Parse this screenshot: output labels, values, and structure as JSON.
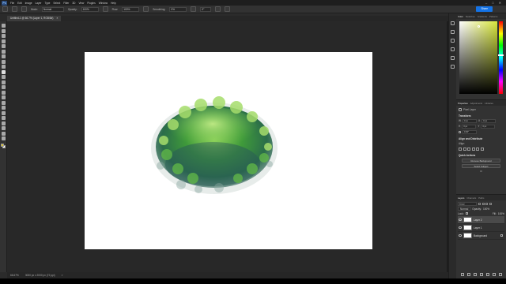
{
  "app": {
    "menu": [
      "File",
      "Edit",
      "Image",
      "Layer",
      "Type",
      "Select",
      "Filter",
      "3D",
      "View",
      "Plugins",
      "Window",
      "Help"
    ],
    "window_controls": [
      "–",
      "□",
      "✕"
    ]
  },
  "options_bar": {
    "mode_label": "Mode:",
    "mode_value": "Normal",
    "opacity_label": "Opacity:",
    "opacity_value": "100%",
    "flow_label": "Flow:",
    "flow_value": "100%",
    "smoothing_label": "Smoothing:",
    "smoothing_value": "0%",
    "angle_value": "0°",
    "share_label": "Share"
  },
  "document": {
    "tab_title": "Untitled-1 @ 66.7% (Layer 1, RGB/8#)",
    "tab_close": "×",
    "canvas_bg": "#ffffff"
  },
  "status": {
    "zoom": "66.67%",
    "size": "3000 px x 2000 px (72 ppi)",
    "arrow": ">"
  },
  "colors": {
    "foreground": "#d9c227",
    "background": "#ffffff",
    "accent": "#1473e6"
  },
  "color_panel": {
    "tabs": [
      "Color",
      "Swatches",
      "Gradients",
      "Patterns"
    ]
  },
  "properties": {
    "tabs": [
      "Properties",
      "Adjustments",
      "Libraries"
    ],
    "layer_type": "Pixel Layer",
    "transform_title": "Transform",
    "w_label": "W",
    "w_value": "0 px",
    "h_label": "H",
    "h_value": "0 px",
    "x_label": "X",
    "x_value": "0 px",
    "y_label": "Y",
    "y_value": "0 px",
    "angle_value": "0.00°",
    "align_title": "Align and Distribute",
    "align_sub": "Align:",
    "quick_actions_title": "Quick Actions",
    "remove_bg_label": "Remove Background",
    "select_subject_label": "Select Subject",
    "more_label": "•••"
  },
  "layers_panel": {
    "tabs": [
      "Layers",
      "Channels",
      "Paths"
    ],
    "search_placeholder": "Kind",
    "blend_mode": "Normal",
    "opacity_label": "Opacity:",
    "opacity_value": "100%",
    "lock_label": "Lock:",
    "fill_label": "Fill:",
    "fill_value": "100%",
    "layers": [
      {
        "name": "Layer 2",
        "selected": true
      },
      {
        "name": "Layer 1",
        "selected": false
      },
      {
        "name": "Background",
        "selected": false
      }
    ]
  },
  "tools": [
    "move-tool",
    "artboard-tool",
    "marquee-tool",
    "lasso-tool",
    "object-select-tool",
    "crop-tool",
    "frame-tool",
    "eyedropper-tool",
    "healing-brush-tool",
    "brush-tool",
    "clone-stamp-tool",
    "history-brush-tool",
    "eraser-tool",
    "gradient-tool",
    "blur-tool",
    "dodge-tool",
    "pen-tool",
    "type-tool",
    "path-select-tool",
    "rectangle-tool",
    "hand-tool",
    "zoom-tool",
    "more-tools"
  ]
}
